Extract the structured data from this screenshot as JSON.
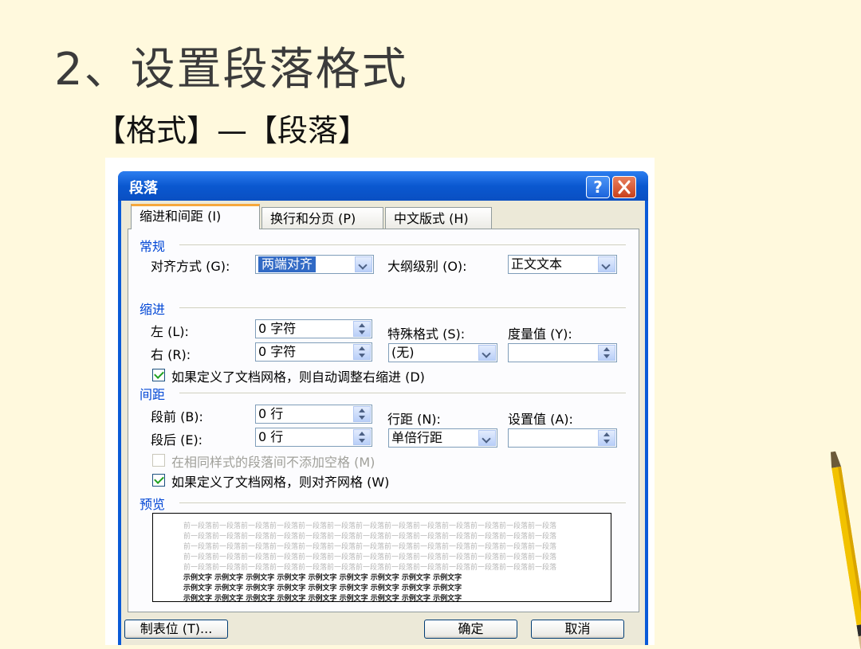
{
  "slide": {
    "title": "2、设置段落格式",
    "subtitle": "【格式】—【段落】"
  },
  "dialog": {
    "title": "段落",
    "help_label": "?",
    "tabs": [
      {
        "label": "缩进和间距 (I)",
        "active": true
      },
      {
        "label": "换行和分页 (P)",
        "active": false
      },
      {
        "label": "中文版式 (H)",
        "active": false
      }
    ],
    "general": {
      "heading": "常规",
      "alignment_label": "对齐方式 (G):",
      "alignment_value": "两端对齐",
      "outline_label": "大纲级别 (O):",
      "outline_value": "正文文本"
    },
    "indent": {
      "heading": "缩进",
      "left_label": "左 (L):",
      "left_value": "0 字符",
      "right_label": "右 (R):",
      "right_value": "0 字符",
      "special_label": "特殊格式 (S):",
      "special_value": "(无)",
      "by_label": "度量值 (Y):",
      "by_value": "",
      "grid_check_label": "如果定义了文档网格，则自动调整右缩进 (D)",
      "grid_check_checked": true
    },
    "spacing": {
      "heading": "间距",
      "before_label": "段前 (B):",
      "before_value": "0 行",
      "after_label": "段后 (E):",
      "after_value": "0 行",
      "line_label": "行距 (N):",
      "line_value": "单倍行距",
      "at_label": "设置值 (A):",
      "at_value": "",
      "no_space_label": "在相同样式的段落间不添加空格 (M)",
      "no_space_checked": false,
      "snap_label": "如果定义了文档网格，则对齐网格 (W)",
      "snap_checked": true
    },
    "preview": {
      "heading": "预览",
      "prev_text": "前一段落前一段落前一段落前一段落前一段落前一段落前一段落前一段落前一段落前一段落前一段落前一段落前一段落",
      "sample_text": "示例文字 示例文字 示例文字 示例文字 示例文字 示例文字 示例文字 示例文字 示例文字"
    },
    "buttons": {
      "tabs": "制表位 (T)...",
      "ok": "确定",
      "cancel": "取消"
    }
  },
  "colors": {
    "slide_bg": "#fff9dd",
    "titlebar": "#0a58d0",
    "group_heading": "#0046d5",
    "selection": "#316ac5"
  }
}
